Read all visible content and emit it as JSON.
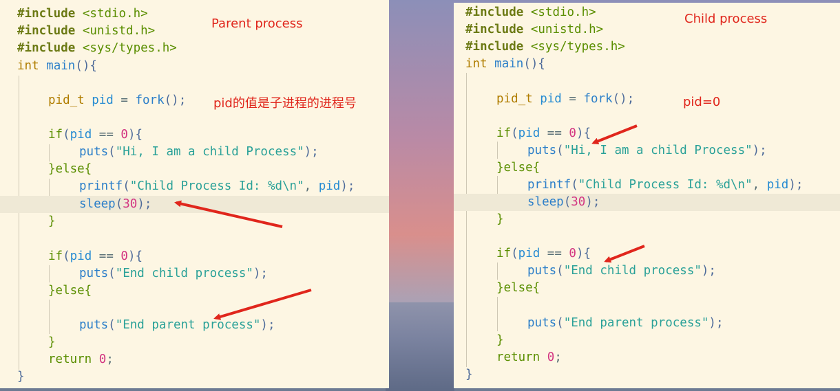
{
  "left": {
    "label": "Parent process",
    "note": "pid的值是子进程的进程号",
    "code": {
      "l1a": "#include",
      "l1b": "<stdio.h>",
      "l2a": "#include",
      "l2b": "<unistd.h>",
      "l3a": "#include",
      "l3b": "<sys/types.h>",
      "l4a": "int",
      "l4b": "main",
      "l4c": "(){",
      "l6a": "pid_t",
      "l6b": "pid",
      "l6c": "=",
      "l6d": "fork",
      "l6e": "();",
      "l8a": "if",
      "l8b": "(",
      "l8c": "pid",
      "l8d": "==",
      "l8e": "0",
      "l8f": "){",
      "l9a": "puts",
      "l9b": "(",
      "l9c": "\"Hi, I am a child Process\"",
      "l9d": ");",
      "l10": "}else{",
      "l11a": "printf",
      "l11b": "(",
      "l11c": "\"Child Process Id: %d\\n\"",
      "l11d": ",",
      "l11e": "pid",
      "l11f": ");",
      "l12a": "sleep",
      "l12b": "(",
      "l12c": "30",
      "l12d": ");",
      "l13": "}",
      "l15a": "if",
      "l15b": "(",
      "l15c": "pid",
      "l15d": "==",
      "l15e": "0",
      "l15f": "){",
      "l16a": "puts",
      "l16b": "(",
      "l16c": "\"End child process\"",
      "l16d": ");",
      "l17": "}else{",
      "l19a": "puts",
      "l19b": "(",
      "l19c": "\"End parent process\"",
      "l19d": ");",
      "l20": "}",
      "l21a": "return",
      "l21b": "0",
      "l21c": ";",
      "l22": "}"
    }
  },
  "right": {
    "label": "Child process",
    "note": "pid=0"
  },
  "colors": {
    "arrow": "#e0261c",
    "panel_bg": "#fdf6e3"
  }
}
